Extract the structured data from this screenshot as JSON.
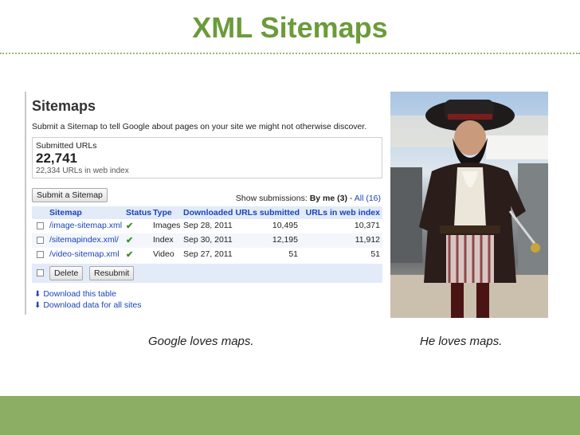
{
  "slide": {
    "title": "XML Sitemaps",
    "caption_left": "Google loves maps.",
    "caption_right": "He loves maps."
  },
  "webmaster": {
    "heading": "Sitemaps",
    "description": "Submit a Sitemap to tell Google about pages on your site we might not otherwise discover.",
    "submitted_label": "Submitted URLs",
    "submitted_count": "22,741",
    "indexed_text": "22,334 URLs in web index",
    "submit_button": "Submit a Sitemap",
    "show_submissions_label": "Show submissions:",
    "by_me": "By me (3)",
    "separator": "-",
    "all": "All (16)",
    "columns": {
      "sitemap": "Sitemap",
      "status": "Status",
      "type": "Type",
      "downloaded": "Downloaded",
      "urls_submitted": "URLs submitted",
      "urls_indexed": "URLs in web index"
    },
    "rows": [
      {
        "sitemap": "/image-sitemap.xml",
        "status": "✔",
        "type": "Images",
        "downloaded": "Sep 28, 2011",
        "urls_submitted": "10,495",
        "urls_indexed": "10,371"
      },
      {
        "sitemap": "/sitemapindex.xml/",
        "status": "✔",
        "type": "Index",
        "downloaded": "Sep 30, 2011",
        "urls_submitted": "12,195",
        "urls_indexed": "11,912"
      },
      {
        "sitemap": "/video-sitemap.xml",
        "status": "✔",
        "type": "Video",
        "downloaded": "Sep 27, 2011",
        "urls_submitted": "51",
        "urls_indexed": "51"
      }
    ],
    "delete_button": "Delete",
    "resubmit_button": "Resubmit",
    "download_table": "Download this table",
    "download_all": "Download data for all sites",
    "download_arrow": "⬇"
  },
  "colors": {
    "title_green": "#6b9b3a",
    "footer_green": "#8cae64",
    "link_blue": "#1a44b8",
    "status_green": "#3c8a2a"
  }
}
